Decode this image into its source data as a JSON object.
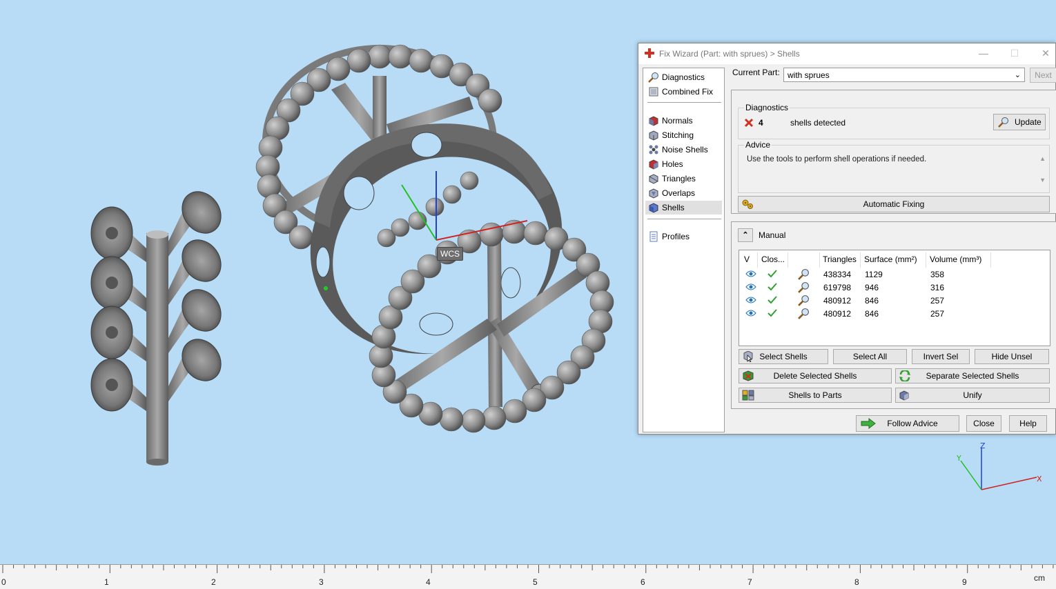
{
  "dialog": {
    "title": "Fix Wizard (Part: with sprues) > Shells",
    "min_glyph": "—",
    "max_glyph": "☐",
    "close_glyph": "✕"
  },
  "nav": {
    "items": [
      {
        "label": "Diagnostics",
        "icon": "magnifier-icon"
      },
      {
        "label": "Combined Fix",
        "icon": "combined-fix-icon"
      },
      {
        "label": "Normals",
        "icon": "normals-cube-icon"
      },
      {
        "label": "Stitching",
        "icon": "stitching-cube-icon"
      },
      {
        "label": "Noise Shells",
        "icon": "noise-shells-icon"
      },
      {
        "label": "Holes",
        "icon": "holes-cube-icon"
      },
      {
        "label": "Triangles",
        "icon": "triangles-cube-icon"
      },
      {
        "label": "Overlaps",
        "icon": "overlaps-cube-icon"
      },
      {
        "label": "Shells",
        "icon": "shells-cube-icon"
      },
      {
        "label": "Profiles",
        "icon": "profiles-document-icon"
      }
    ],
    "active": "Shells"
  },
  "current_part": {
    "label": "Current Part:",
    "value": "with sprues",
    "next_label": "Next"
  },
  "diagnostics": {
    "group_label": "Diagnostics",
    "count": "4",
    "status_text": "shells detected",
    "update_label": "Update"
  },
  "advice": {
    "group_label": "Advice",
    "text": "Use the tools to perform shell operations if needed."
  },
  "automatic_fixing_label": "Automatic Fixing",
  "manual": {
    "title": "Manual",
    "collapse_glyph": "⌃",
    "table": {
      "columns": [
        "V",
        "Clos...",
        "",
        "Triangles",
        "Surface (mm²)",
        "Volume (mm³)"
      ],
      "rows": [
        {
          "triangles": "438334",
          "surface": "1129",
          "volume": "358"
        },
        {
          "triangles": "619798",
          "surface": "946",
          "volume": "316"
        },
        {
          "triangles": "480912",
          "surface": "846",
          "volume": "257"
        },
        {
          "triangles": "480912",
          "surface": "846",
          "volume": "257"
        }
      ]
    },
    "buttons": {
      "select_shells": "Select Shells",
      "select_all": "Select All",
      "invert_sel": "Invert Sel",
      "hide_unsel": "Hide Unsel",
      "delete_selected": "Delete Selected Shells",
      "separate_selected": "Separate Selected Shells",
      "shells_to_parts": "Shells to Parts",
      "unify": "Unify"
    }
  },
  "footer": {
    "follow_advice": "Follow Advice",
    "close": "Close",
    "help": "Help"
  },
  "viewport": {
    "wcs_label": "WCS",
    "axis_labels": {
      "z": "Z",
      "y": "Y",
      "x": "X"
    }
  },
  "ruler": {
    "ticks": [
      "0",
      "1",
      "2",
      "3",
      "4",
      "5",
      "6",
      "7",
      "8",
      "9"
    ],
    "unit": "cm"
  },
  "colors": {
    "background": "#b8dcf6",
    "model_gray": "#8a8a8a",
    "error_red": "#d03020",
    "check_green": "#30a030",
    "axis_x": "#d02020",
    "axis_y": "#20c020",
    "axis_z": "#2040d0"
  }
}
